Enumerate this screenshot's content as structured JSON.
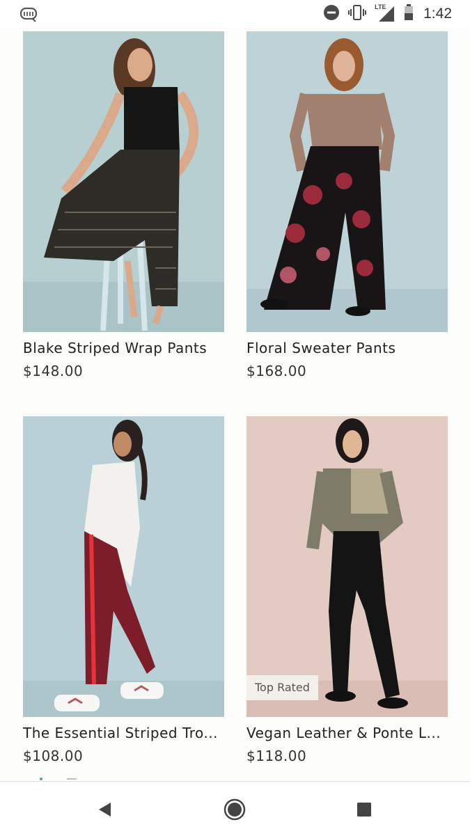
{
  "status_bar": {
    "time": "1:42",
    "network_label": "LTE",
    "icons": [
      "app-logo-icon",
      "do-not-disturb-icon",
      "vibrate-icon",
      "signal-icon",
      "battery-icon"
    ]
  },
  "products": [
    {
      "name": "Blake Striped Wrap Pants",
      "price": "$148.00",
      "badge": ""
    },
    {
      "name": "Floral Sweater Pants",
      "price": "$168.00",
      "badge": ""
    },
    {
      "name": "The Essential Striped Tro...",
      "price": "$108.00",
      "badge": ""
    },
    {
      "name": "Vegan Leather & Ponte L...",
      "price": "$118.00",
      "badge": "Top Rated"
    }
  ],
  "colors": {
    "page_bg": "#fcfcfa",
    "photo_bg_blue": "#b9d0d3",
    "photo_bg_pink": "#e4cbc4",
    "badge_bg": "#f3efea"
  },
  "nav_bar": {
    "icons": [
      "back-icon",
      "home-icon",
      "recents-icon"
    ]
  }
}
